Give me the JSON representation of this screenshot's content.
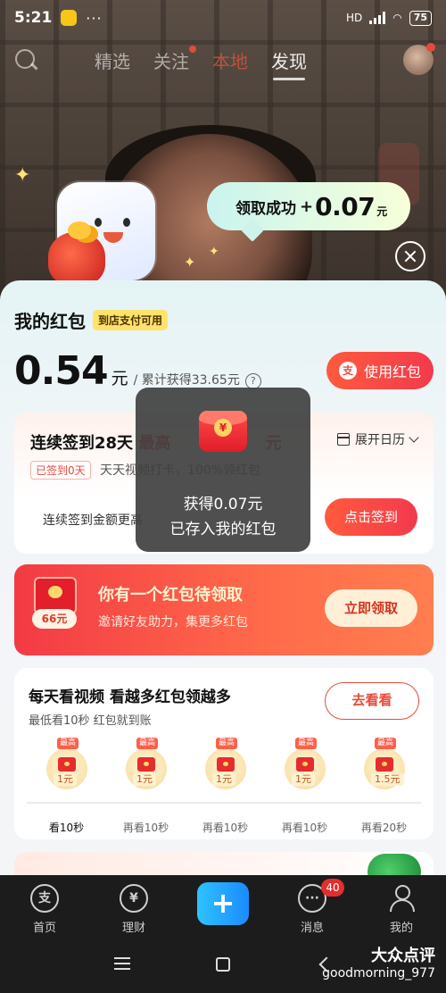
{
  "status_bar": {
    "time": "5:21",
    "dots": "···",
    "network": "HD",
    "battery": "75"
  },
  "top_nav": {
    "tabs": [
      "精选",
      "关注",
      "本地",
      "发现"
    ],
    "active": "发现"
  },
  "popup": {
    "success_text": "领取成功",
    "plus": "+",
    "amount": "0.07",
    "unit": "元"
  },
  "wallet": {
    "title": "我的红包",
    "tag": "到店支付可用",
    "balance": "0.54",
    "balance_unit": "元",
    "cumulative": "/ 累计获得33.65元",
    "help": "?",
    "use_button": "使用红包",
    "use_icon_glyph": "支"
  },
  "signin": {
    "title_prefix": "连续签到28天",
    "title_max": "最高",
    "title_tail": "元",
    "calendar_label": "展开日历",
    "signed_badge": "已签到0天",
    "desc": "天天视频打卡，100%领红包",
    "note": "连续签到金额更高",
    "button": "点击签到"
  },
  "invite": {
    "tag": "66元",
    "title": "你有一个红包待领取",
    "subtitle": "邀请好友助力，集更多红包",
    "button": "立即领取"
  },
  "video": {
    "title": "每天看视频 看越多红包领越多",
    "subtitle": "最低看10秒 红包就到账",
    "button": "去看看",
    "rewards": [
      {
        "max_label": "最高",
        "amount": "1元",
        "label": "看10秒"
      },
      {
        "max_label": "最高",
        "amount": "1元",
        "label": "再看10秒"
      },
      {
        "max_label": "最高",
        "amount": "1元",
        "label": "再看10秒"
      },
      {
        "max_label": "最高",
        "amount": "1元",
        "label": "再看10秒"
      },
      {
        "max_label": "最高",
        "amount": "1.5元",
        "label": "再看20秒"
      }
    ]
  },
  "toast": {
    "line1": "获得0.07元",
    "line2": "已存入我的红包"
  },
  "tabbar": {
    "items": [
      {
        "label": "首页",
        "glyph": "支"
      },
      {
        "label": "理财",
        "glyph": "¥"
      },
      {
        "label": "",
        "glyph": "+"
      },
      {
        "label": "消息",
        "glyph": "···",
        "badge": "40"
      },
      {
        "label": "我的",
        "glyph": ""
      }
    ]
  },
  "watermark": {
    "brand": "大众点评",
    "user": "goodmorning_977"
  }
}
